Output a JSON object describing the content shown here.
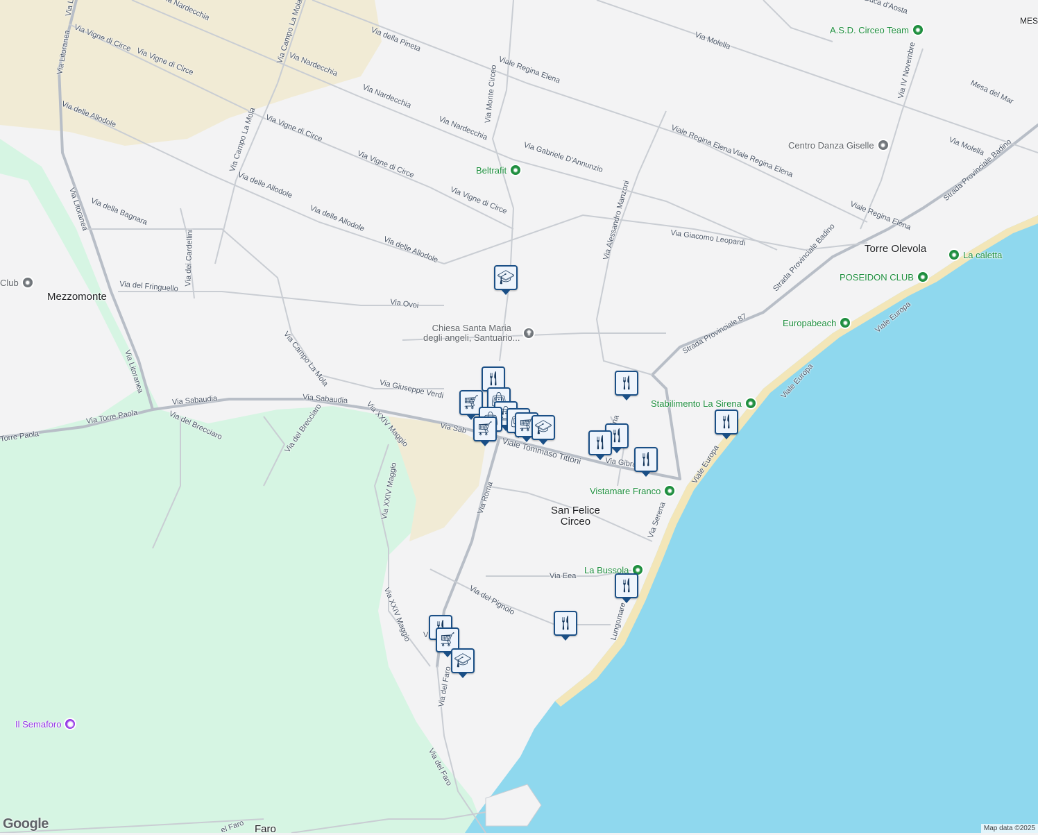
{
  "map": {
    "colors": {
      "land": "#f3f3f4",
      "park": "#d6f5e3",
      "sand": "#f1ebd5",
      "water": "#8fd8ee",
      "road": "#c9cdd3",
      "major_road": "#b8bec7",
      "marker_border": "#1a4f86",
      "poi_green": "#1e8e3e"
    },
    "towns": [
      {
        "name": "Mezzomonte"
      },
      {
        "name": "San Felice\nCirceo"
      },
      {
        "name": "Torre Olevola"
      },
      {
        "name": "Faro"
      },
      {
        "name": "MES"
      }
    ],
    "roads": [
      "Via Nardecchia",
      "Via Campo La Mola",
      "Via della Pineta",
      "Via Monte Circeo",
      "Viale Regina Elena",
      "Via Molella",
      "Via Vigne di Circe",
      "Via Vigne di Circe",
      "Via Nardecchia",
      "Via Nardecchia",
      "Via Nardecchia",
      "Via Gabriele D'Annunzio",
      "Via delle Allodole",
      "Via Campo La Mola",
      "Via Vigne di Circe",
      "Via Vigne di Circe",
      "Via Vigne di Circe",
      "Via Litoranea",
      "Via Litoranea",
      "Via delle Allodole",
      "Via delle Allodole",
      "Via delle Allodole",
      "Via della Bagnara",
      "Via dei Cardellini",
      "Via del Fringuello",
      "Via Ovoi",
      "Via Alessandro Manzoni",
      "Via Giacomo Leopardi",
      "Viale Regina Elena",
      "Viale Regina Elena",
      "Viale Regina Elena",
      "Via IV Novembre",
      "Mesa del Mar",
      "Via Molella",
      "Strada Provinciale Badino",
      "Strada Provinciale Badino",
      "Strada Provinciale 87",
      "Via Campo La Mola",
      "Via Giuseppe Verdi",
      "Via Sabaudia",
      "Via Sabaudia",
      "Via Torre Paola",
      "Via Litoranea",
      "Via del Brecciaro",
      "Via del Brecciaro",
      "Via XXIV Maggio",
      "Via Sab",
      "Viale Tommaso Tittoni",
      "Via XXIV Maggio",
      "Via Roma",
      "Via Gibral",
      "Viale Europa",
      "Viale Europa",
      "Viale Europa",
      "Via Serena",
      "Via Eea",
      "Via del Pignolo",
      "Lungomare",
      "Via XXIV Maggio",
      "V",
      "Via del Faro",
      "Via del Faro",
      "el Faro",
      "Torre Paola",
      "Via Lito",
      "Duca d'Aosta",
      "ina"
    ],
    "pois": [
      {
        "name": "A.S.D. Circeo Team",
        "icon": "fitness-icon"
      },
      {
        "name": "Centro Danza Giselle",
        "icon": "place-icon"
      },
      {
        "name": "Beltrafit",
        "icon": "fitness-icon"
      },
      {
        "name": "Chiesa Santa Maria\ndegli angeli, Santuario...",
        "icon": "church-icon"
      },
      {
        "name": "La caletta",
        "icon": "beach-icon"
      },
      {
        "name": "POSEIDON CLUB",
        "icon": "beach-icon"
      },
      {
        "name": "Europabeach",
        "icon": "beach-icon"
      },
      {
        "name": "Stabilimento La Sirena",
        "icon": "beach-icon"
      },
      {
        "name": "Vistamare Franco",
        "icon": "beach-icon"
      },
      {
        "name": "La Bussola",
        "icon": "beach-icon"
      },
      {
        "name": "Club",
        "icon": "place-icon"
      },
      {
        "name": "Il Semaforo",
        "icon": "camera-icon"
      }
    ],
    "markers": [
      {
        "type": "school",
        "icon": "school-icon"
      },
      {
        "type": "restaurant",
        "icon": "restaurant-icon"
      },
      {
        "type": "restaurant",
        "icon": "restaurant-icon"
      },
      {
        "type": "shopping",
        "icon": "shopping-bag-icon"
      },
      {
        "type": "grocery",
        "icon": "shopping-cart-icon"
      },
      {
        "type": "shopping",
        "icon": "shopping-bag-icon"
      },
      {
        "type": "shopping",
        "icon": "shopping-bag-icon"
      },
      {
        "type": "shopping",
        "icon": "shopping-bag-icon"
      },
      {
        "type": "grocery",
        "icon": "shopping-cart-icon"
      },
      {
        "type": "grocery",
        "icon": "shopping-cart-icon"
      },
      {
        "type": "school",
        "icon": "school-icon"
      },
      {
        "type": "restaurant",
        "icon": "restaurant-icon"
      },
      {
        "type": "restaurant",
        "icon": "restaurant-icon"
      },
      {
        "type": "restaurant",
        "icon": "restaurant-icon"
      },
      {
        "type": "restaurant",
        "icon": "restaurant-icon"
      },
      {
        "type": "restaurant",
        "icon": "restaurant-icon"
      },
      {
        "type": "restaurant",
        "icon": "restaurant-icon"
      },
      {
        "type": "restaurant",
        "icon": "restaurant-icon"
      },
      {
        "type": "grocery",
        "icon": "shopping-cart-icon"
      },
      {
        "type": "school",
        "icon": "school-icon"
      }
    ],
    "logo": "Google",
    "attribution": "Map data ©2025"
  }
}
